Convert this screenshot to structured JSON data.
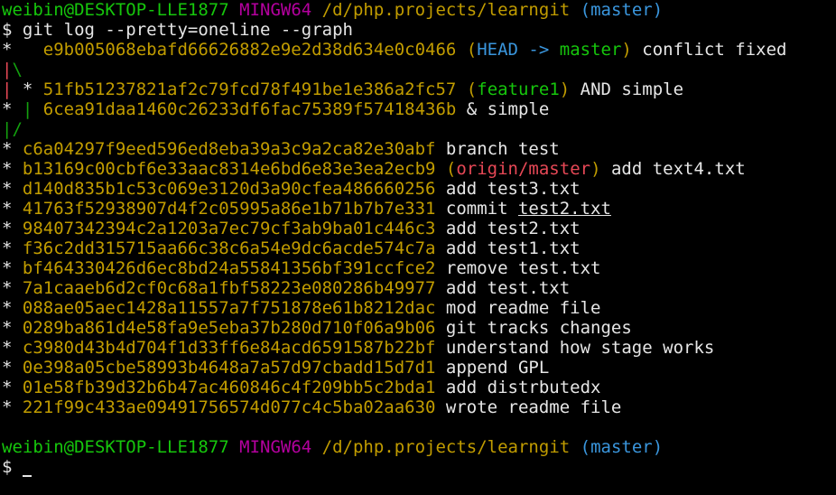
{
  "prompt1": {
    "user": "weibin@DESKTOP-LLE1877",
    "shell": "MINGW64",
    "path": "/d/php.projects/learngit",
    "branch": "(master)"
  },
  "command": {
    "symbol": "$",
    "text": "git log --pretty=oneline --graph"
  },
  "graph": {
    "head_line": {
      "graph": "*   ",
      "hash": "e9b005068ebafd66626882e9e2d38d634e0c0466",
      "ref_open": "(",
      "ref_head": "HEAD -> ",
      "ref_branch": "master",
      "ref_close": ")",
      "message": "conflict fixed"
    },
    "branch_out": {
      "left": "|",
      "right": "\\"
    },
    "feature_line": {
      "bar": "|",
      "graph": " * ",
      "hash": "51fb51237821af2c79fcd78f491be1e386a2fc57",
      "ref_open": "(",
      "ref_branch": "feature1",
      "ref_close": ")",
      "message": "AND simple"
    },
    "master_line": {
      "graph": "* | ",
      "hash": "6cea91daa1460c26233df6fac75389f57418436b",
      "message": "& simple"
    },
    "merge": "|/",
    "origin_line": {
      "graph": "* ",
      "hash": "b13169c00cbf6e33aac8314e6bd6e83e3ea2ecb9",
      "ref_open": "(",
      "ref_branch": "origin/master",
      "ref_close": ")",
      "message": "add text4.txt"
    },
    "test2_line": {
      "graph": "* ",
      "hash": "41763f52938907d4f2c05995a86e1b71b7b7e331",
      "message_prefix": "commit ",
      "message_link": "test2.txt"
    }
  },
  "commits_before_origin": [
    {
      "graph": "* ",
      "hash": "c6a04297f9eed596ed8eba39a3c9a2ca82e30abf",
      "message": "branch test"
    }
  ],
  "commits_mid": [
    {
      "graph": "* ",
      "hash": "d140d835b1c53c069e3120d3a90cfea486660256",
      "message": "add test3.txt"
    }
  ],
  "commits_after": [
    {
      "graph": "* ",
      "hash": "98407342394c2a1203a7ec79cf3ab9ba01c446c3",
      "message": "add test2.txt"
    },
    {
      "graph": "* ",
      "hash": "f36c2dd315715aa66c38c6a54e9dc6acde574c7a",
      "message": "add test1.txt"
    },
    {
      "graph": "* ",
      "hash": "bf464330426d6ec8bd24a55841356bf391ccfce2",
      "message": "remove test.txt"
    },
    {
      "graph": "* ",
      "hash": "7a1caaeb6d2cf0c68a1fbf58223e080286b49977",
      "message": "add test.txt"
    },
    {
      "graph": "* ",
      "hash": "088ae05aec1428a11557a7f751878e61b8212dac",
      "message": "mod readme file"
    },
    {
      "graph": "* ",
      "hash": "0289ba861d4e58fa9e5eba37b280d710f06a9b06",
      "message": "git tracks changes"
    },
    {
      "graph": "* ",
      "hash": "c3980d43b4d704f1d33ff6e84acd6591587b22bf",
      "message": "understand how stage works"
    },
    {
      "graph": "* ",
      "hash": "0e398a05cbe58993b4648a7a57d97cbadd15d7d1",
      "message": "append GPL"
    },
    {
      "graph": "* ",
      "hash": "01e58fb39d32b6b47ac460846c4f209bb5c2bda1",
      "message": "add distrbutedx"
    },
    {
      "graph": "* ",
      "hash": "221f99c433ae09491756574d077c4c5ba02aa630",
      "message": "wrote readme file"
    }
  ],
  "prompt2": {
    "user": "weibin@DESKTOP-LLE1877",
    "shell": "MINGW64",
    "path": "/d/php.projects/learngit",
    "branch": "(master)",
    "symbol": "$"
  },
  "colors": {
    "background": "#000000",
    "text": "#e6e6e6",
    "user": "#16c60c",
    "shell": "#b4009e",
    "path": "#c19c00",
    "branch": "#3a96dd",
    "graph_red": "#e74856",
    "graph_green": "#13a10e"
  }
}
